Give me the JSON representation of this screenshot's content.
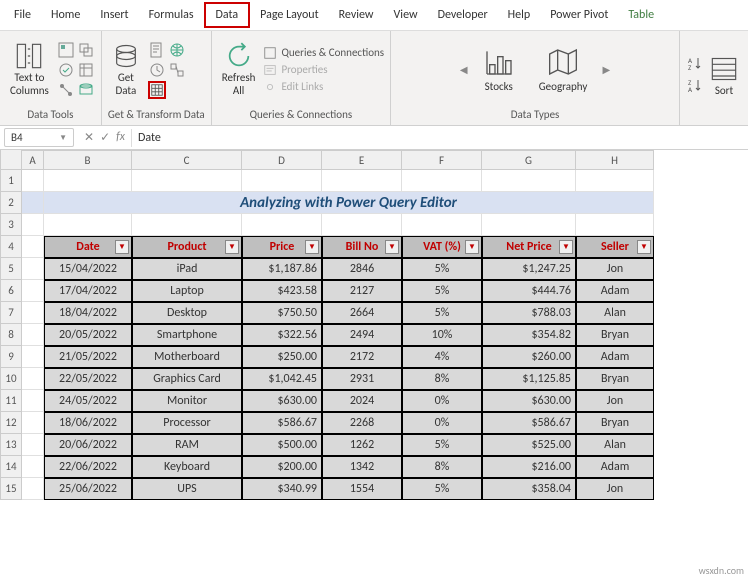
{
  "ribbon": {
    "tabs": [
      "File",
      "Home",
      "Insert",
      "Formulas",
      "Data",
      "Page Layout",
      "Review",
      "View",
      "Developer",
      "Help",
      "Power Pivot",
      "Table"
    ],
    "active_tab": "Data",
    "groups": {
      "data_tools": {
        "label": "Data Tools",
        "text_to_columns": "Text to\nColumns"
      },
      "get_transform": {
        "label": "Get & Transform Data",
        "get_data": "Get\nData"
      },
      "queries": {
        "label": "Queries & Connections",
        "refresh_all": "Refresh\nAll",
        "queries_conn": "Queries & Connections",
        "properties": "Properties",
        "edit_links": "Edit Links"
      },
      "data_types": {
        "label": "Data Types",
        "stocks": "Stocks",
        "geography": "Geography"
      },
      "sort_filter": {
        "sort": "Sort"
      }
    }
  },
  "formula_bar": {
    "name_box": "B4",
    "value": "Date"
  },
  "columns": [
    "A",
    "B",
    "C",
    "D",
    "E",
    "F",
    "G",
    "H"
  ],
  "row_numbers": [
    "1",
    "2",
    "3",
    "4",
    "5",
    "6",
    "7",
    "8",
    "9",
    "10",
    "11",
    "12",
    "13",
    "14",
    "15"
  ],
  "title": "Analyzing with Power Query Editor",
  "table": {
    "headers": [
      "Date",
      "Product",
      "Price",
      "Bill No",
      "VAT (%)",
      "Net Price",
      "Seller"
    ],
    "rows": [
      [
        "15/04/2022",
        "iPad",
        "$1,187.86",
        "2846",
        "5%",
        "$1,247.25",
        "Jon"
      ],
      [
        "17/04/2022",
        "Laptop",
        "$423.58",
        "2127",
        "5%",
        "$444.76",
        "Adam"
      ],
      [
        "18/04/2022",
        "Desktop",
        "$750.50",
        "2664",
        "5%",
        "$788.03",
        "Alan"
      ],
      [
        "20/05/2022",
        "Smartphone",
        "$322.56",
        "2494",
        "10%",
        "$354.82",
        "Bryan"
      ],
      [
        "21/05/2022",
        "Motherboard",
        "$250.00",
        "2172",
        "4%",
        "$260.00",
        "Adam"
      ],
      [
        "22/05/2022",
        "Graphics Card",
        "$1,042.45",
        "2931",
        "8%",
        "$1,125.85",
        "Bryan"
      ],
      [
        "24/05/2022",
        "Monitor",
        "$630.00",
        "2024",
        "0%",
        "$630.00",
        "Jon"
      ],
      [
        "18/06/2022",
        "Processor",
        "$586.67",
        "2268",
        "0%",
        "$586.67",
        "Bryan"
      ],
      [
        "20/06/2022",
        "RAM",
        "$500.00",
        "1262",
        "5%",
        "$525.00",
        "Alan"
      ],
      [
        "22/06/2022",
        "Keyboard",
        "$200.00",
        "1342",
        "8%",
        "$216.00",
        "Adam"
      ],
      [
        "25/06/2022",
        "UPS",
        "$340.99",
        "1554",
        "5%",
        "$358.04",
        "Jon"
      ]
    ]
  },
  "watermark": "wsxdn.com"
}
